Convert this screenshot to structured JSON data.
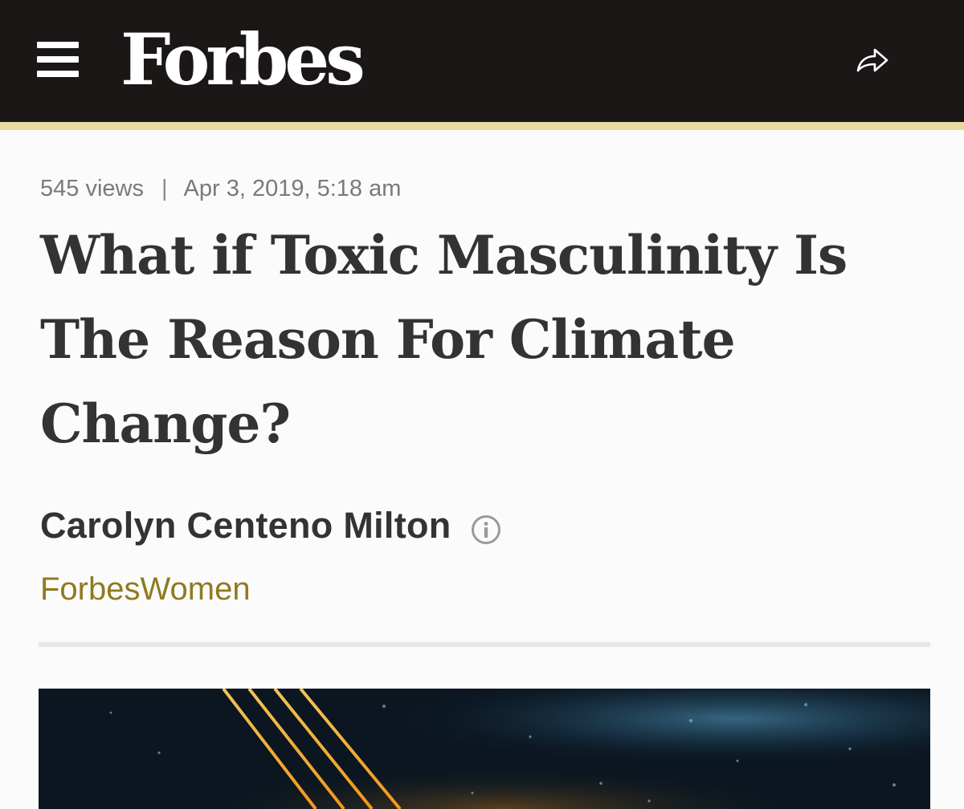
{
  "header": {
    "logo_text": "Forbes",
    "background_color": "#1a1716",
    "accent_rule_color": "#e8d9a0",
    "menu_icon": "hamburger-menu-icon",
    "share_icon": "share-arrow-icon"
  },
  "article": {
    "views": "545 views",
    "separator": "|",
    "timestamp": "Apr 3, 2019, 5:18 am",
    "headline": "What if Toxic Masculinity Is The Reason For Climate Change?",
    "author": "Carolyn Centeno Milton",
    "author_info_icon": "info-circle-icon",
    "section": "ForbesWomen",
    "section_color": "#8f7a1f"
  }
}
